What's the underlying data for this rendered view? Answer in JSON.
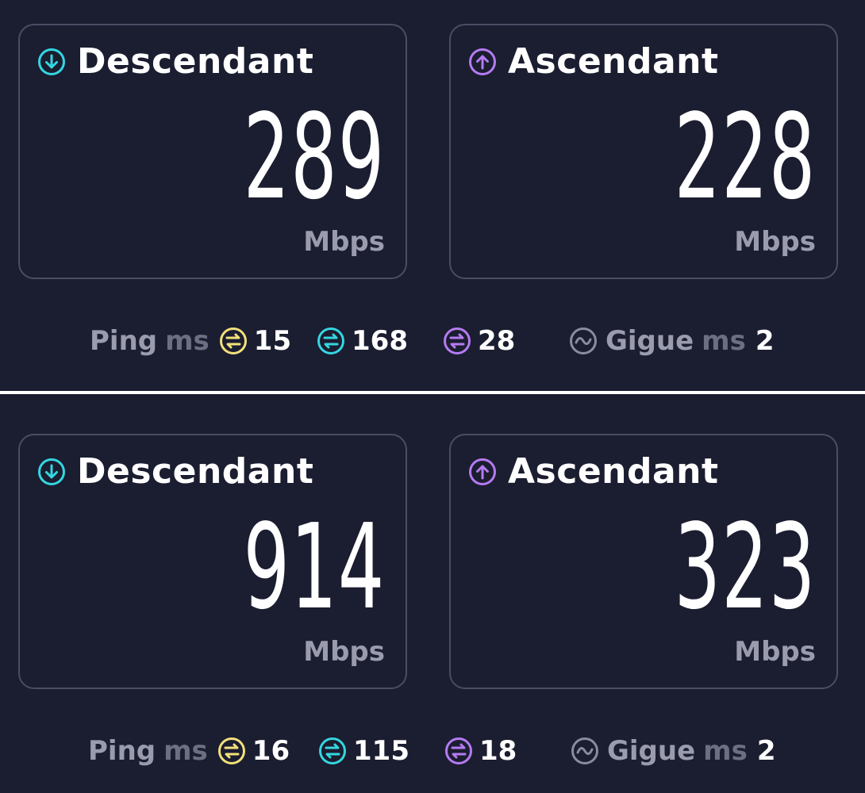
{
  "colors": {
    "download_accent": "#34d6e0",
    "upload_accent": "#b57bf2",
    "ping_idle_accent": "#f2e07a",
    "jitter_accent": "#8a8c9e",
    "background": "#1b1d30",
    "card_border": "#4a4d63"
  },
  "results": [
    {
      "download": {
        "title": "Descendant",
        "value": "289",
        "unit": "Mbps",
        "icon": "download-arrow-icon"
      },
      "upload": {
        "title": "Ascendant",
        "value": "228",
        "unit": "Mbps",
        "icon": "upload-arrow-icon"
      },
      "ping": {
        "label": "Ping",
        "unit": "ms",
        "idle": "15",
        "download": "168",
        "upload": "28"
      },
      "jitter": {
        "label": "Gigue",
        "unit": "ms",
        "value": "2"
      }
    },
    {
      "download": {
        "title": "Descendant",
        "value": "914",
        "unit": "Mbps",
        "icon": "download-arrow-icon"
      },
      "upload": {
        "title": "Ascendant",
        "value": "323",
        "unit": "Mbps",
        "icon": "upload-arrow-icon"
      },
      "ping": {
        "label": "Ping",
        "unit": "ms",
        "idle": "16",
        "download": "115",
        "upload": "18"
      },
      "jitter": {
        "label": "Gigue",
        "unit": "ms",
        "value": "2"
      }
    }
  ]
}
